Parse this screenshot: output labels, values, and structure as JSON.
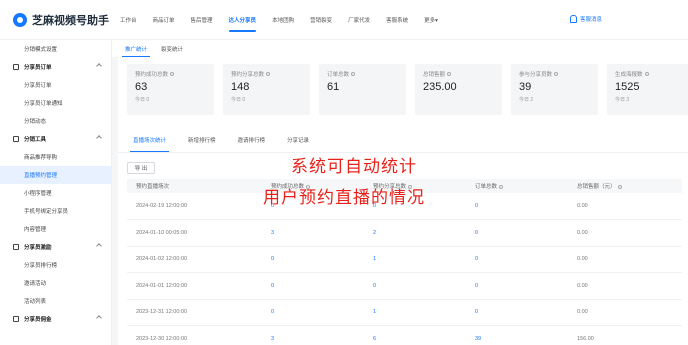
{
  "app": {
    "title": "芝麻视频号助手"
  },
  "topnav": [
    "工作台",
    "商品订单",
    "售后管理",
    "达人分享员",
    "本地团购",
    "营销裂变",
    "厂家代发",
    "客服系统",
    "更多▾"
  ],
  "topnav_active_index": 3,
  "notification": "客服消息",
  "sidebar": {
    "r0": "分销模式设置",
    "g1": "分享员订单",
    "r1": "分享员订单",
    "r2": "分享员订单通知",
    "r3": "分销动态",
    "g2": "分销工具",
    "r4": "商品推荐导购",
    "r5": "直播预约管理",
    "r6": "小程序管理",
    "r7": "手机号绑定分享员",
    "r8": "内容管理",
    "g3": "分享员激励",
    "r9": "分享员排行榜",
    "r10": "邀请活动",
    "r11": "活动列表",
    "g4": "分享员佣金"
  },
  "subtabs": [
    "推广统计",
    "裂变统计"
  ],
  "stats": [
    {
      "label": "预约成功总数",
      "value": "63",
      "sub": "今日 0"
    },
    {
      "label": "预约分享总数",
      "value": "148",
      "sub": "今日 0"
    },
    {
      "label": "订单总数",
      "value": "61",
      "sub": ""
    },
    {
      "label": "总销售额",
      "value": "235.00",
      "sub": ""
    },
    {
      "label": "参与分享员数",
      "value": "39",
      "sub": "今日 2"
    },
    {
      "label": "生成海报数",
      "value": "1525",
      "sub": "今日 3"
    }
  ],
  "panel_tabs": [
    "直播场次统计",
    "新增排行榜",
    "邀请排行榜",
    "分享记录"
  ],
  "export_label": "导 出",
  "table": {
    "headers": [
      "预约直播场次",
      "预约成功总数",
      "预约分享总数",
      "订单总数",
      "总销售额（元）"
    ],
    "rows": [
      [
        "2024-02-19 12:00:00",
        "0",
        "0",
        "0",
        "0.00"
      ],
      [
        "2024-01-10 00:05:00",
        "3",
        "2",
        "0",
        "0.00"
      ],
      [
        "2024-01-02 12:00:00",
        "0",
        "1",
        "0",
        "0.00"
      ],
      [
        "2024-01-01 12:00:00",
        "0",
        "0",
        "0",
        "0.00"
      ],
      [
        "2023-12-31 12:00:00",
        "0",
        "1",
        "0",
        "0.00"
      ],
      [
        "2023-12-30 12:00:00",
        "3",
        "6",
        "39",
        "156.00"
      ]
    ]
  },
  "overlay": {
    "line1": "系统可自动统计",
    "line2": "用户预约直播的情况"
  },
  "colors": {
    "accent": "#1677ff",
    "overlay_text": "#e8221b"
  }
}
